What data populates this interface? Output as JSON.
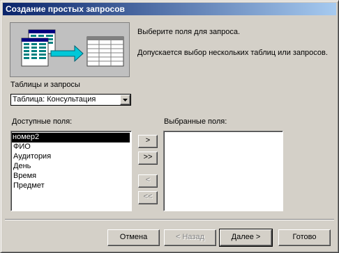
{
  "window": {
    "title": "Создание простых запросов"
  },
  "intro": {
    "line1": "Выберите поля для запроса.",
    "line2": "Допускается выбор нескольких таблиц или запросов."
  },
  "tables": {
    "label": "Таблицы и запросы",
    "selected": "Таблица: Консультация"
  },
  "available": {
    "label": "Доступные поля:",
    "items": [
      "номер2",
      "ФИО",
      "Аудитория",
      "День",
      "Время",
      "Предмет"
    ],
    "selected_index": 0
  },
  "chosen": {
    "label": "Выбранные поля:",
    "items": []
  },
  "move_buttons": {
    "add_one": ">",
    "add_all": ">>",
    "remove_one": "<",
    "remove_all": "<<"
  },
  "footer": {
    "cancel": "Отмена",
    "back": "< Назад",
    "next": "Далее >",
    "finish": "Готово"
  }
}
